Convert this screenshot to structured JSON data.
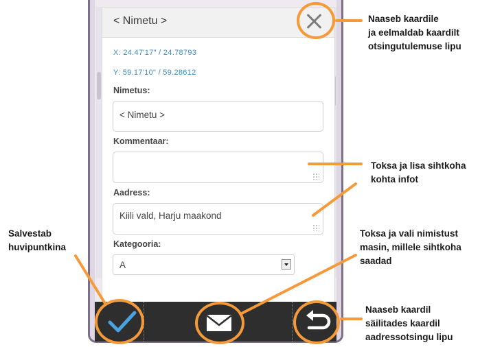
{
  "card": {
    "title": "< Nimetu >",
    "x_coord": "X: 24.47'17\" / 24.78793",
    "y_coord": "Y: 59.17'10\" / 59.28612",
    "name_label": "Nimetus:",
    "name_value": "< Nimetu >",
    "comment_label": "Kommentaar:",
    "comment_value": "",
    "address_label": "Aadress:",
    "address_value": "Kiili vald, Harju maakond",
    "category_label": "Kategooria:",
    "category_value": "A"
  },
  "toolbar": {
    "save_icon": "check-icon",
    "send_icon": "mail-icon",
    "back_icon": "return-arrow-icon"
  },
  "callouts": {
    "close_line1": "Naaseb kaardile",
    "close_line2": "ja eelmaldab kaardilt",
    "close_line3": "otsingutulemuse lipu",
    "info_line1": "Toksa ja lisa sihtkoha",
    "info_line2": "kohta infot",
    "machine_line1": "Toksa ja vali nimistust",
    "machine_line2": "masin, millele sihtkoha",
    "machine_line3": "saadad",
    "save_line1": "Salvestab",
    "save_line2": "huvipuntkina",
    "back_line1": "Naaseb kaardil",
    "back_line2": "säilitades kaardil",
    "back_line3": "aadressotsingu lipu"
  },
  "colors": {
    "accent_orange": "#f59a3a",
    "coord_blue": "#3b8bbf",
    "check_blue": "#4aa3df",
    "toolbar_bg": "#2e2e2e"
  }
}
